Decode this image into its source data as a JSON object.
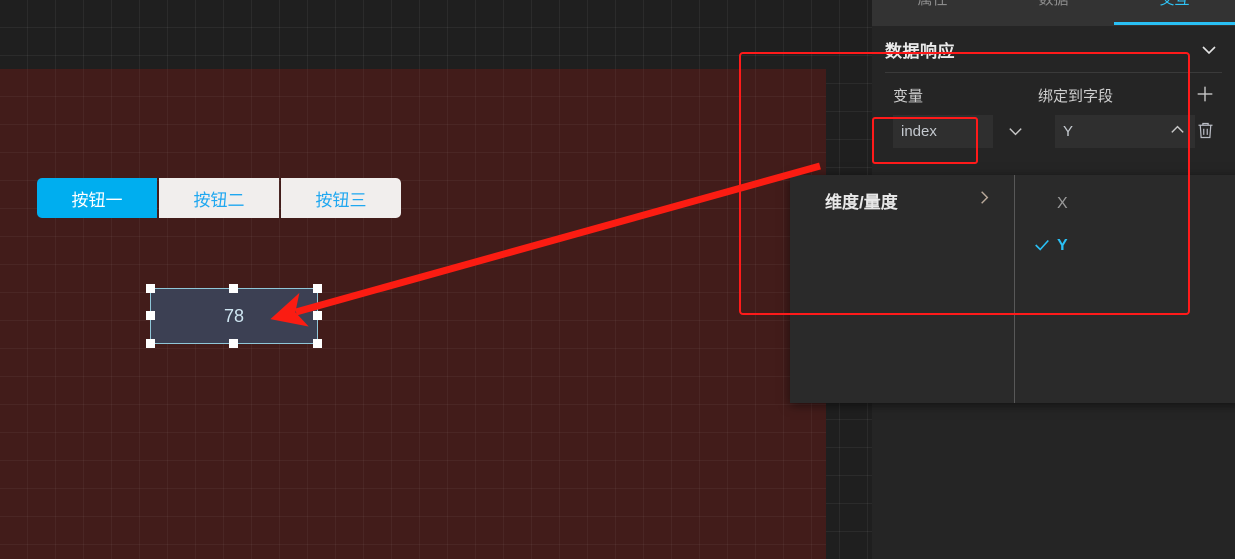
{
  "canvas": {
    "artboard_bg": "#421c1a",
    "buttons": [
      {
        "label": "按钮一",
        "active": true
      },
      {
        "label": "按钮二",
        "active": false
      },
      {
        "label": "按钮三",
        "active": false
      }
    ],
    "selected_widget": {
      "value": "78",
      "name": "text-widget"
    }
  },
  "right_panel": {
    "tabs": [
      {
        "label": "属性",
        "active": false
      },
      {
        "label": "数据",
        "active": false
      },
      {
        "label": "交互",
        "active": true
      }
    ],
    "section": {
      "title": "数据响应",
      "collapse_icon": "chevron-down-icon"
    },
    "bindings": {
      "column_variable_label": "变量",
      "column_field_label": "绑定到字段",
      "rows": [
        {
          "variable": "index",
          "variable_chevron": "chevron-down-icon",
          "field": "Y",
          "field_chevron": "chevron-up-icon"
        }
      ],
      "add_icon": "plus-icon",
      "delete_icon": "trash-icon"
    }
  },
  "dropdown": {
    "left_items": [
      {
        "label": "维度/量度",
        "chevron": "chevron-right-icon"
      }
    ],
    "right_options": [
      {
        "label": "X",
        "checked": false
      },
      {
        "label": "Y",
        "checked": true
      }
    ],
    "check_icon": "check-icon"
  },
  "annotations": {
    "accent_color": "#ff1a1a",
    "highlight_rect_label": "data-response-section-highlight",
    "highlight_field_label": "index-variable-highlight",
    "arrow_label": "pointer-arrow-to-widget"
  },
  "colors": {
    "accent_cyan": "#29c0f5",
    "panel_bg": "#252525",
    "canvas_bg": "#1f1f1f",
    "artboard_bg": "#421c1a",
    "widget_bg": "#3c4053"
  }
}
